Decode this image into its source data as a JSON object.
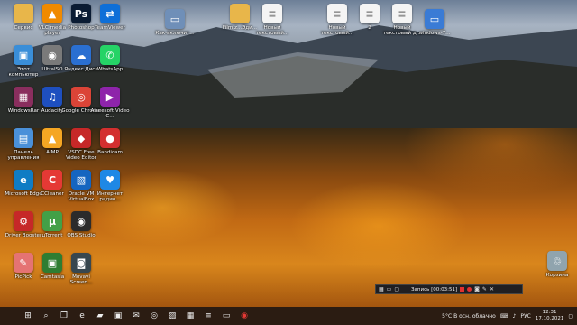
{
  "desktop_icons": [
    {
      "label": "Сервис",
      "icon": "folder-icon",
      "color": "#e8b64a",
      "glyph": ""
    },
    {
      "label": "VLC media player",
      "icon": "vlc-icon",
      "color": "#f08a00",
      "glyph": "▲"
    },
    {
      "label": "Photoshop",
      "icon": "photoshop-icon",
      "color": "#0a1b33",
      "glyph": "Ps"
    },
    {
      "label": "TeamViewer",
      "icon": "teamviewer-icon",
      "color": "#0e6fd8",
      "glyph": "⇄"
    },
    {
      "label": "Как-включит...",
      "icon": "image-file-icon",
      "color": "#6f8fb8",
      "glyph": "▭"
    },
    {
      "label": "Film.z...Эди...",
      "icon": "folder-icon",
      "color": "#e8b64a",
      "glyph": ""
    },
    {
      "label": "Новый текстовый...",
      "icon": "text-document-icon",
      "color": "#f4f4f4",
      "glyph": "≡"
    },
    {
      "label": "Новый текстовый...",
      "icon": "text-document-icon",
      "color": "#f4f4f4",
      "glyph": "≡"
    },
    {
      "label": "2",
      "icon": "text-document-icon",
      "color": "#f4f4f4",
      "glyph": "≡"
    },
    {
      "label": "Новый текстовый д...",
      "icon": "text-document-icon",
      "color": "#f4f4f4",
      "glyph": "≡"
    },
    {
      "label": "windows-7...",
      "icon": "image-file-icon",
      "color": "#3a7bd5",
      "glyph": "▭"
    },
    {
      "label": "Этот компьютер",
      "icon": "computer-icon",
      "color": "#3a8ed8",
      "glyph": "▣"
    },
    {
      "label": "UltraISO",
      "icon": "ultraiso-icon",
      "color": "#7a7a7a",
      "glyph": "◉"
    },
    {
      "label": "Яндекс.Диск",
      "icon": "yandex-disk-icon",
      "color": "#2a6fd1",
      "glyph": "☁"
    },
    {
      "label": "WhatsApp",
      "icon": "whatsapp-icon",
      "color": "#25d366",
      "glyph": "✆"
    },
    {
      "label": "WindowsRar",
      "icon": "winrar-icon",
      "color": "#8a2e5e",
      "glyph": "▦"
    },
    {
      "label": "Audacity",
      "icon": "audacity-icon",
      "color": "#1e4fbf",
      "glyph": "♫"
    },
    {
      "label": "Google Chrome",
      "icon": "chrome-icon",
      "color": "#db4437",
      "glyph": "◎"
    },
    {
      "label": "Aiseesoft Video C...",
      "icon": "aiseesoft-icon",
      "color": "#8e24aa",
      "glyph": "▶"
    },
    {
      "label": "Панель управления",
      "icon": "control-panel-icon",
      "color": "#4a90d9",
      "glyph": "▤"
    },
    {
      "label": "AIMP",
      "icon": "aimp-icon",
      "color": "#f5a623",
      "glyph": "▲"
    },
    {
      "label": "VSDC Free Video Editor",
      "icon": "vsdc-icon",
      "color": "#c62828",
      "glyph": "◆"
    },
    {
      "label": "Bandicam",
      "icon": "bandicam-icon",
      "color": "#d32f2f",
      "glyph": "●"
    },
    {
      "label": "Microsoft Edge",
      "icon": "edge-icon",
      "color": "#0f7cc4",
      "glyph": "e"
    },
    {
      "label": "CCleaner",
      "icon": "ccleaner-icon",
      "color": "#e53935",
      "glyph": "C"
    },
    {
      "label": "Oracle VM VirtualBox",
      "icon": "virtualbox-icon",
      "color": "#1565c0",
      "glyph": "▧"
    },
    {
      "label": "Интернет радио...",
      "icon": "radio-icon",
      "color": "#1e88e5",
      "glyph": "♥"
    },
    {
      "label": "Driver Booster",
      "icon": "driver-booster-icon",
      "color": "#c62828",
      "glyph": "⚙"
    },
    {
      "label": "µTorrent",
      "icon": "utorrent-icon",
      "color": "#43a047",
      "glyph": "µ"
    },
    {
      "label": "OBS Studio",
      "icon": "obs-icon",
      "color": "#2b2b2b",
      "glyph": "◉"
    },
    {
      "label": "Корзина",
      "icon": "recycle-bin-icon",
      "color": "#90a4ae",
      "glyph": "♲"
    },
    {
      "label": "PicPick",
      "icon": "picpick-icon",
      "color": "#e57373",
      "glyph": "✎"
    },
    {
      "label": "Camtasia",
      "icon": "camtasia-icon",
      "color": "#2e7d32",
      "glyph": "▣"
    },
    {
      "label": "Movavi Screen...",
      "icon": "movavi-icon",
      "color": "#37474f",
      "glyph": "◙"
    }
  ],
  "recorder": {
    "title": "Запись [00:03:51]"
  },
  "taskbar": {
    "items": [
      "start-icon",
      "search-icon",
      "task-view-icon",
      "edge-icon",
      "file-explorer-icon",
      "store-icon",
      "mail-icon",
      "chrome-icon",
      "photos-icon",
      "calculator-icon",
      "notepad-icon",
      "screenshot-icon",
      "record-icon"
    ],
    "weather": "5°C  В осн. облачно",
    "lang": "РУС",
    "time": "12:31",
    "date": "17.10.2021"
  }
}
